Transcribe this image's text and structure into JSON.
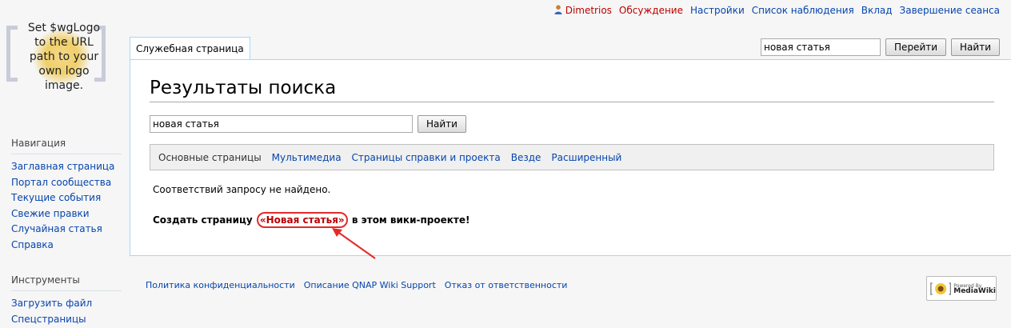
{
  "personal": {
    "username": "Dimetrios",
    "talk": "Обсуждение",
    "preferences": "Настройки",
    "watchlist": "Список наблюдения",
    "contributions": "Вклад",
    "logout": "Завершение сеанса"
  },
  "logo": {
    "line1": "Set $wgLogo",
    "line2": "to the URL",
    "line3": "path to your",
    "line4": "own logo",
    "line5": "image."
  },
  "tab": {
    "label": "Служебная страница"
  },
  "top_search": {
    "value": "новая статья",
    "go_label": "Перейти",
    "search_label": "Найти"
  },
  "main": {
    "title": "Результаты поиска",
    "search_value": "новая статья",
    "search_button": "Найти",
    "profiles": [
      "Основные страницы",
      "Мультимедиа",
      "Страницы справки и проекта",
      "Везде",
      "Расширенный"
    ],
    "no_results": "Соответствий запросу не найдено.",
    "create_prefix": "Создать страницу ",
    "create_link": "«Новая статья»",
    "create_suffix": " в этом вики-проекте!"
  },
  "sidebar": {
    "navigation_title": "Навигация",
    "navigation": [
      "Заглавная страница",
      "Портал сообщества",
      "Текущие события",
      "Свежие правки",
      "Случайная статья",
      "Справка"
    ],
    "tools_title": "Инструменты",
    "tools": [
      "Загрузить файл",
      "Спецстраницы"
    ]
  },
  "footer": {
    "links": [
      "Политика конфиденциальности",
      "Описание QNAP Wiki Support",
      "Отказ от ответственности"
    ],
    "powered_by_line1": "Powered By",
    "powered_by_line2": "MediaWiki"
  },
  "colors": {
    "link": "#0645ad",
    "new_link": "#ba0000",
    "annotation": "#e32a2a",
    "border": "#a7d7f9"
  }
}
